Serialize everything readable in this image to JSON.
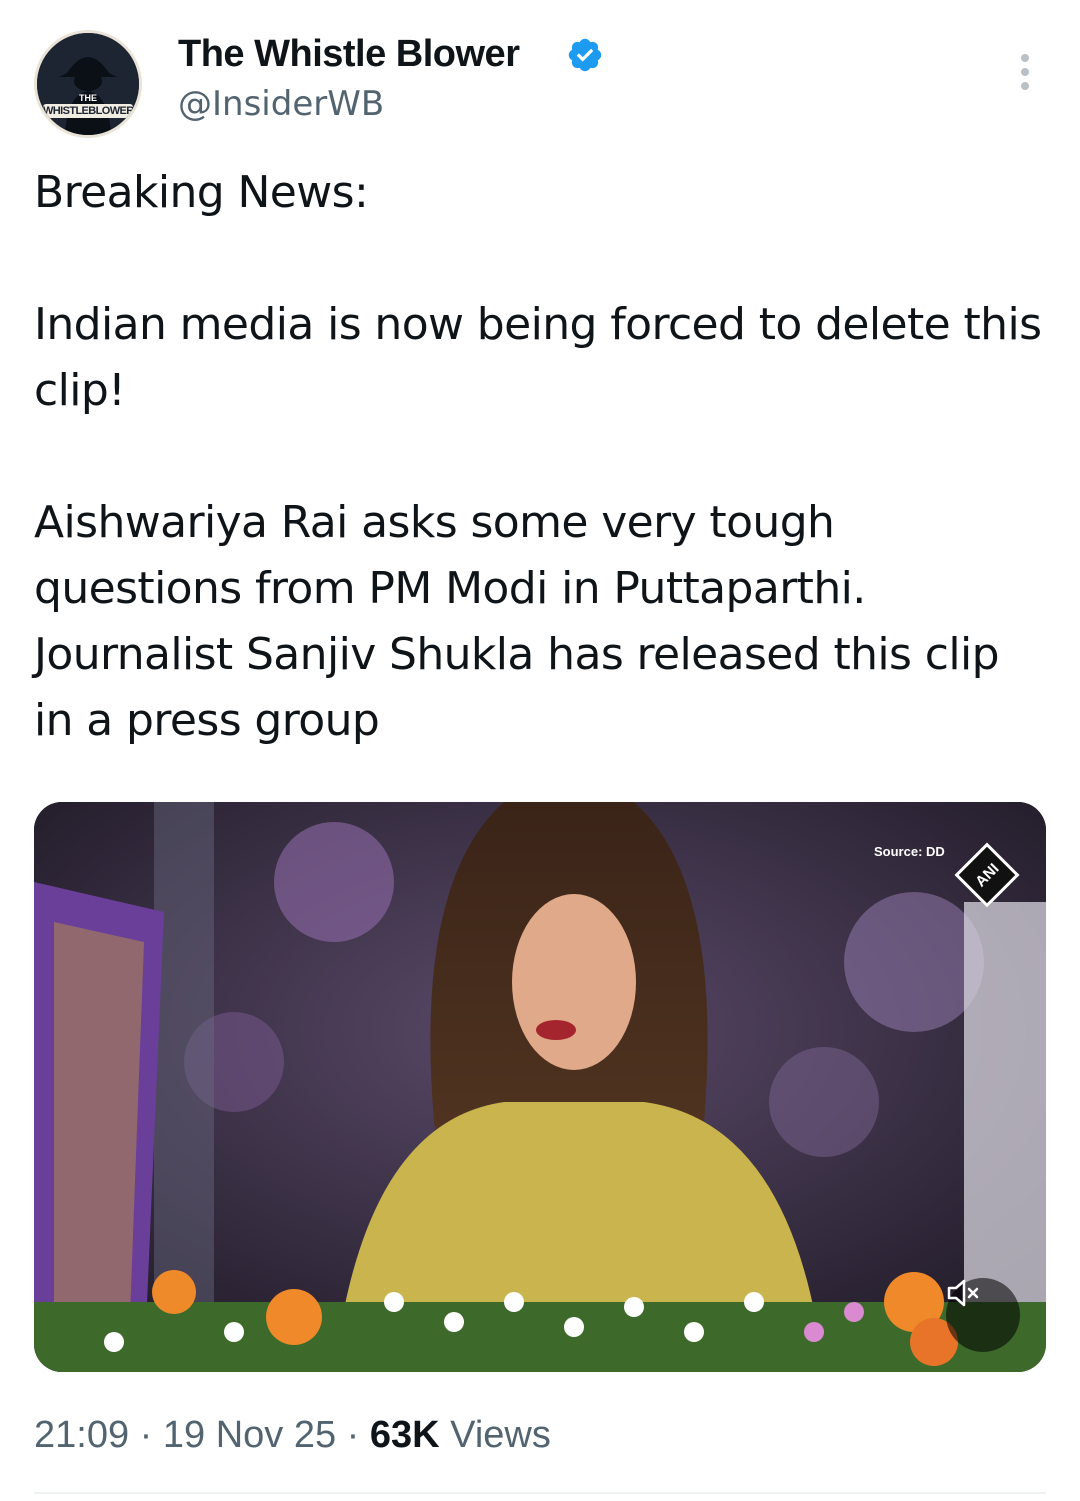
{
  "author": {
    "display_name": "The Whistle Blower",
    "handle": "@InsiderWB",
    "verified_icon": "verified-badge-icon",
    "avatar_text_top": "THE",
    "avatar_text_bottom": "WHISTLEBLOWER",
    "verified_color": "#1d9bf0"
  },
  "tweet": {
    "paragraphs": [
      "Breaking News:",
      "Indian media is now being forced to delete this clip!",
      "Aishwariya Rai asks some very tough questions from PM Modi in Puttaparthi. Journalist Sanjiv Shukla has released this clip in a press group"
    ]
  },
  "media": {
    "source_label": "Source: DD",
    "watermark": "ANI",
    "mute_icon": "muted-speaker-icon"
  },
  "meta": {
    "time": "21:09",
    "separator": "·",
    "date": "19 Nov 25",
    "views_count": "63K",
    "views_label": "Views"
  },
  "colors": {
    "text_primary": "#0f1419",
    "text_secondary": "#536471"
  }
}
